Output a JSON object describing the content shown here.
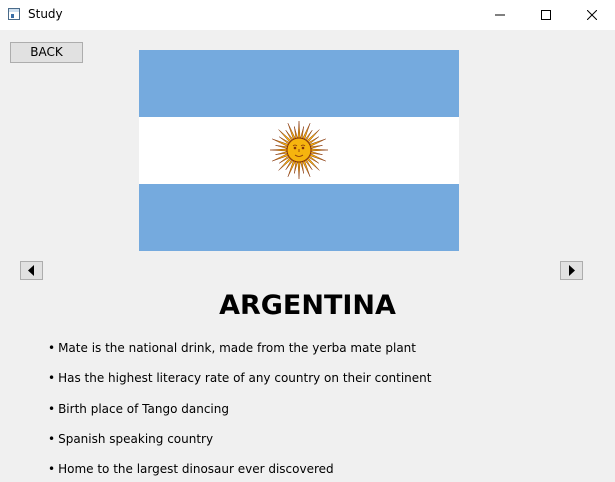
{
  "window": {
    "title": "Study"
  },
  "toolbar": {
    "back_label": "BACK"
  },
  "icons": {
    "app": "app-window-icon",
    "minimize": "minimize-icon",
    "maximize": "maximize-icon",
    "close": "close-icon",
    "prev": "triangle-left-icon",
    "next": "triangle-right-icon"
  },
  "flag": {
    "name": "flag-of-argentina",
    "colors": {
      "stripe_blue": "#75aade",
      "stripe_white": "#ffffff",
      "sun": "#f6b40e",
      "sun_outline": "#85340a"
    }
  },
  "country": {
    "name": "ARGENTINA"
  },
  "facts": [
    "Mate is the national drink, made from the yerba mate plant",
    "Has the highest literacy rate of any country on their continent",
    "Birth place of Tango dancing",
    "Spanish speaking country",
    "Home to the largest dinosaur ever discovered"
  ]
}
